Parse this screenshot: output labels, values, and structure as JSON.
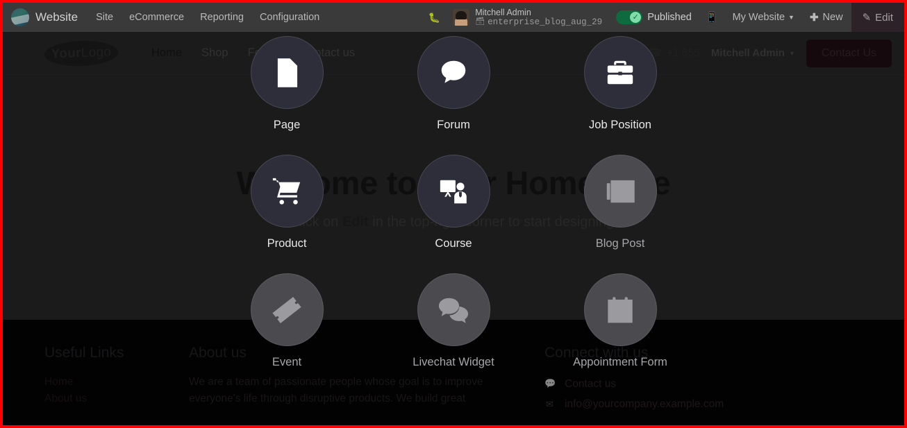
{
  "systembar": {
    "brand_icon": "odoo-logo-icon",
    "brand": "Website",
    "menus": [
      "Site",
      "eCommerce",
      "Reporting",
      "Configuration"
    ],
    "bug_icon": "bug-icon",
    "user_name": "Mitchell Admin",
    "database_icon": "database-icon",
    "database": "enterprise_blog_aug_29",
    "publish_state": "Published",
    "publish_check_icon": "check-circle-icon",
    "mobile_preview_icon": "mobile-icon",
    "site_selector": "My Website",
    "site_selector_caret_icon": "chevron-down-icon",
    "new_plus_icon": "plus-icon",
    "new_label": "New",
    "edit_pencil_icon": "pencil-icon",
    "edit_label": "Edit"
  },
  "site": {
    "logo_bold": "Your",
    "logo_light": "Logo",
    "nav": [
      {
        "label": "Home",
        "active": true
      },
      {
        "label": "Shop",
        "active": false
      },
      {
        "label": "Forum",
        "active": false
      },
      {
        "label": "Contact us",
        "active": false
      }
    ],
    "search_icon": "search-icon",
    "phone_icon": "phone-icon",
    "phone": "+1 555",
    "user_menu": "Mitchell Admin",
    "user_menu_caret_icon": "chevron-down-icon",
    "cta_label": "Contact Us",
    "hero_title": "Welcome to Your Homepage",
    "hero_subtitle_before": "Click on ",
    "hero_subtitle_bold": "Edit",
    "hero_subtitle_after": " in the top-right corner to start designing."
  },
  "footer": {
    "links_title": "Useful Links",
    "links": [
      "Home",
      "About us"
    ],
    "about_title": "About us",
    "about_text": "We are a team of passionate people whose goal is to improve everyone's life through disruptive products. We build great",
    "connect_title": "Connect with us",
    "connect": [
      {
        "icon": "comment-icon",
        "glyph": "●",
        "label": "Contact us"
      },
      {
        "icon": "envelope-icon",
        "glyph": "✉",
        "label": "info@yourcompany.example.com"
      }
    ]
  },
  "picker": {
    "tiles": [
      {
        "label": "Page",
        "icon": "file-icon",
        "enabled": true
      },
      {
        "label": "Forum",
        "icon": "comment-icon",
        "enabled": true
      },
      {
        "label": "Job Position",
        "icon": "briefcase-icon",
        "enabled": true
      },
      {
        "label": "Product",
        "icon": "cart-icon",
        "enabled": true
      },
      {
        "label": "Course",
        "icon": "presenter-icon",
        "enabled": true
      },
      {
        "label": "Blog Post",
        "icon": "newspaper-icon",
        "enabled": false
      },
      {
        "label": "Event",
        "icon": "ticket-icon",
        "enabled": false
      },
      {
        "label": "Livechat Widget",
        "icon": "comments-icon",
        "enabled": false
      },
      {
        "label": "Appointment Form",
        "icon": "calendar-icon",
        "enabled": false
      }
    ]
  },
  "colors": {
    "accent_green": "#0f6b3f",
    "recording_border": "#fe0000",
    "tile_enabled": "#2e2e3a",
    "tile_disabled": "#4a4a4f"
  }
}
